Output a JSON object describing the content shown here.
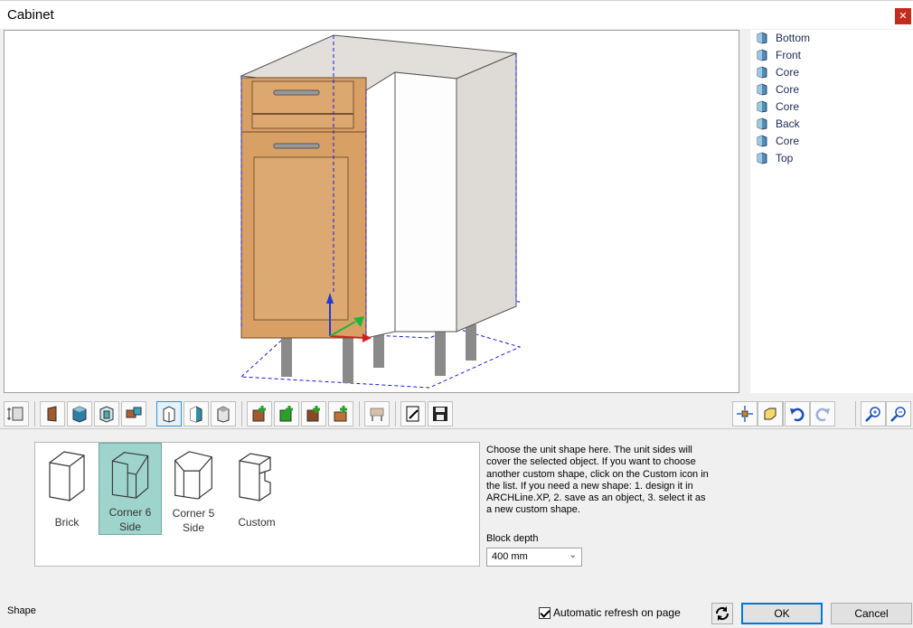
{
  "window": {
    "title": "Cabinet",
    "close_glyph": "✕"
  },
  "tree": {
    "items": [
      {
        "label": "Bottom",
        "icon": "panel-icon"
      },
      {
        "label": "Front",
        "icon": "panel-icon"
      },
      {
        "label": "Core",
        "icon": "panel-icon"
      },
      {
        "label": "Core",
        "icon": "panel-icon"
      },
      {
        "label": "Core",
        "icon": "panel-icon"
      },
      {
        "label": "Back",
        "icon": "panel-icon"
      },
      {
        "label": "Core",
        "icon": "panel-icon"
      },
      {
        "label": "Top",
        "icon": "panel-icon"
      }
    ]
  },
  "shapes": {
    "items": [
      {
        "label": "Brick",
        "icon": "brick-shape-icon",
        "selected": false
      },
      {
        "label": "Corner 6\nSide",
        "icon": "corner-6-side-shape-icon",
        "selected": true
      },
      {
        "label": "Corner 5\nSide",
        "icon": "corner-5-side-shape-icon",
        "selected": false
      },
      {
        "label": "Custom",
        "icon": "custom-shape-icon",
        "selected": false
      }
    ]
  },
  "description": "Choose the unit shape here. The unit sides will cover the selected object. If you want to choose another custom shape, click on the Custom icon in the list. If you need a new shape: 1. design it in ARCHLine.XP, 2. save as an object, 3. select it as a new custom shape.",
  "block_depth": {
    "label": "Block depth",
    "value": "400 mm"
  },
  "status": {
    "label": "Shape"
  },
  "auto_refresh": {
    "label": "Automatic refresh on page",
    "checked": true
  },
  "buttons": {
    "ok": "OK",
    "cancel": "Cancel"
  },
  "colors": {
    "accent": "#0078d7",
    "selected_shape": "#9fd4cc",
    "wood": "#d9a066",
    "close": "#c42b1c"
  }
}
